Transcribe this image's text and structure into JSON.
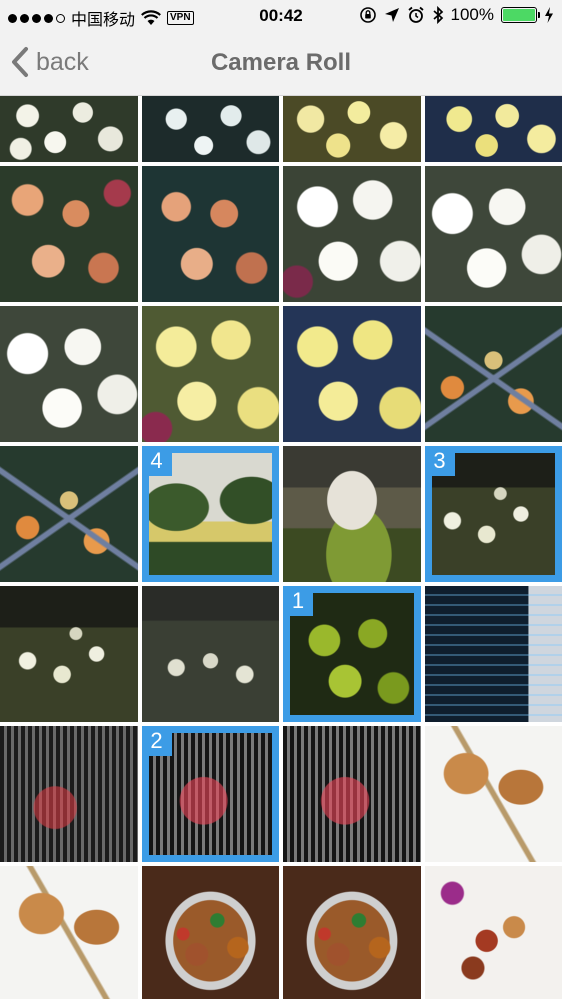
{
  "status_bar": {
    "carrier": "中国移动",
    "vpn": "VPN",
    "time": "00:42",
    "battery": "100%",
    "signal_dots_filled": 4,
    "signal_dots_total": 5,
    "battery_level": 1.0,
    "icons": [
      "wifi-icon",
      "orientation-lock-icon",
      "location-arrow-icon",
      "alarm-icon",
      "bluetooth-icon",
      "battery-icon",
      "charging-bolt-icon"
    ]
  },
  "nav": {
    "back_label": "back",
    "title": "Camera Roll"
  },
  "colors": {
    "selection": "#3c9ce6",
    "nav_background": "#f2f2f2",
    "battery_fill": "#4cd964"
  },
  "photos": [
    {
      "texture": "p-chrys-white",
      "badge": ""
    },
    {
      "texture": "p-chrys-white-dark",
      "badge": ""
    },
    {
      "texture": "p-chrys-yellow",
      "badge": ""
    },
    {
      "texture": "p-chrys-yellow-blue",
      "badge": ""
    },
    {
      "texture": "p-chrys-orange",
      "badge": ""
    },
    {
      "texture": "p-chrys-orange-teal",
      "badge": ""
    },
    {
      "texture": "p-chrys-whitebig",
      "badge": ""
    },
    {
      "texture": "p-chrys-whitebig2",
      "badge": ""
    },
    {
      "texture": "p-chrys-whitebig2",
      "badge": ""
    },
    {
      "texture": "p-chrys-yellowbig",
      "badge": ""
    },
    {
      "texture": "p-chrys-yellowbig-blue",
      "badge": ""
    },
    {
      "texture": "p-frame-garden",
      "badge": ""
    },
    {
      "texture": "p-frame-garden",
      "badge": ""
    },
    {
      "texture": "p-topiary",
      "badge": "4"
    },
    {
      "texture": "p-pavilion",
      "badge": ""
    },
    {
      "texture": "p-night-white",
      "badge": "3"
    },
    {
      "texture": "p-night-white",
      "badge": ""
    },
    {
      "texture": "p-night-white2",
      "badge": ""
    },
    {
      "texture": "p-green-bush",
      "badge": "1"
    },
    {
      "texture": "p-code",
      "badge": ""
    },
    {
      "texture": "p-grill",
      "badge": ""
    },
    {
      "texture": "p-grill2",
      "badge": "2"
    },
    {
      "texture": "p-grill2",
      "badge": ""
    },
    {
      "texture": "p-skewer",
      "badge": ""
    },
    {
      "texture": "p-skewer",
      "badge": ""
    },
    {
      "texture": "p-chicken",
      "badge": ""
    },
    {
      "texture": "p-chicken",
      "badge": ""
    },
    {
      "texture": "p-kungpao",
      "badge": ""
    }
  ]
}
